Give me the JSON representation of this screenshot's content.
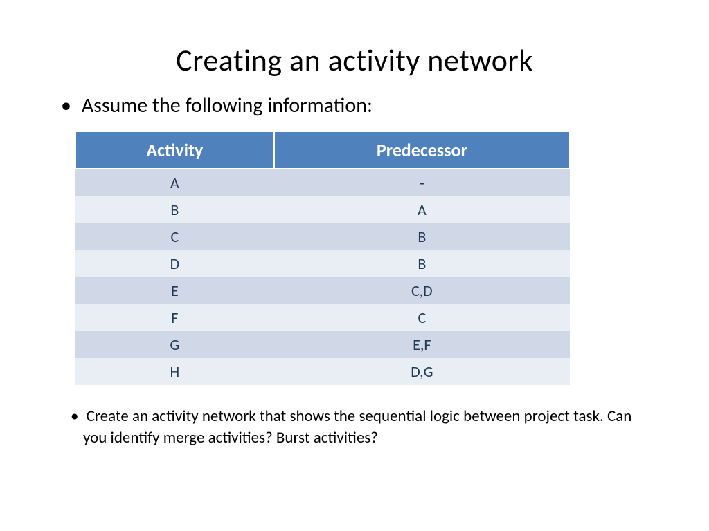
{
  "title": "Creating an activity network",
  "bullet1": "Assume the following information:",
  "table": {
    "headers": [
      "Activity",
      "Predecessor"
    ],
    "rows": [
      [
        "A",
        "-"
      ],
      [
        "B",
        "A"
      ],
      [
        "C",
        "B"
      ],
      [
        "D",
        "B"
      ],
      [
        "E",
        "C,D"
      ],
      [
        "F",
        "C"
      ],
      [
        "G",
        "E,F"
      ],
      [
        "H",
        "D,G"
      ]
    ]
  },
  "bullet2": "Create an activity network that shows the sequential logic between project task. Can you identify merge activities? Burst activities?"
}
